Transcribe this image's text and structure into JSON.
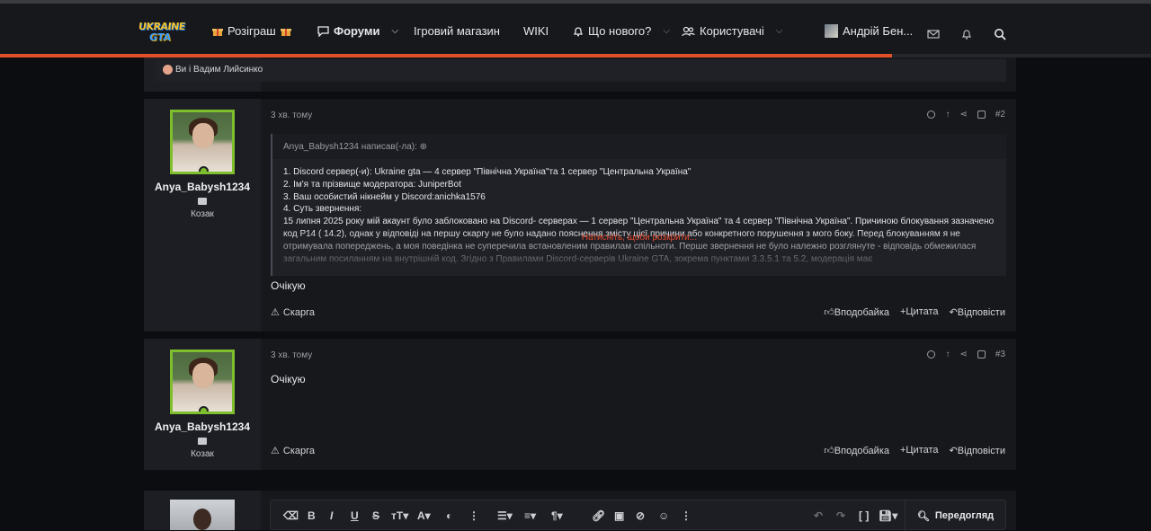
{
  "header": {
    "logo_text_top": "UKRAINE",
    "logo_text_bottom": "GTA",
    "nav": [
      {
        "label": "Розіграш",
        "icon": "gift-icon"
      },
      {
        "label": "Форуми",
        "icon": "chat-icon"
      },
      {
        "label": "Ігровий магазин"
      },
      {
        "label": "WIKI"
      },
      {
        "label": "Що нового?",
        "icon": "bell-icon"
      },
      {
        "label": "Користувачі",
        "icon": "users-icon"
      }
    ],
    "user_label": "Андрій Бен...",
    "progress_percent": 77.5
  },
  "reactions_bar": {
    "text": "Ви і Вадим Лийсинко"
  },
  "posts": [
    {
      "username": "Anya_Babysh1234",
      "rank": "Козак",
      "time": "3 хв. тому",
      "number": "#2",
      "quote_header": "Anya_Babysh1234 написав(-ла):",
      "quote_lines": [
        "1. Discord сервер(-и): Ukraine gta — 4 сервер \"Північна Україна\"та 1 сервер \"Центральна Україна\"",
        "2. Ім'я та прізвище модератора: JuniperBot",
        "3. Ваш особистий нікнейм у Discord:anichka1576",
        "4. Суть звернення:",
        "15 липня 2025 року мій акаунт було заблоковано на Discord- серверах — 1 сервер \"Центральна Україна\" та 4 сервер \"Північна Україна\". Причиною блокування зазначено код P14 ( 14.2), однак у відповіді на першу скаргу не було надано пояснення змісту цієї причини або конкретного порушення з мого боку. Перед блокуванням я не отримувала попереджень, а моя поведінка не суперечила встановленим правилам спільноти. Перше звернення не було належно розглянуте - відповідь обмежилася загальним посиланням на внутрішній код. Згідно з Правилами Discord-серверів Ukraine GTA, зокрема пунктами 3.3.5.1 та 5.2, модерація має"
      ],
      "quote_expand": "Натисніть, щоби розкрити...",
      "message": "Очікую",
      "report": "Скарга",
      "like": "Вподобайка",
      "quote": "Цитата",
      "reply": "Відповісти"
    },
    {
      "username": "Anya_Babysh1234",
      "rank": "Козак",
      "time": "3 хв. тому",
      "number": "#3",
      "message": "Очікую",
      "report": "Скарга",
      "like": "Вподобайка",
      "quote": "Цитата",
      "reply": "Відповісти"
    }
  ],
  "editor": {
    "preview_label": "Передогляд"
  }
}
